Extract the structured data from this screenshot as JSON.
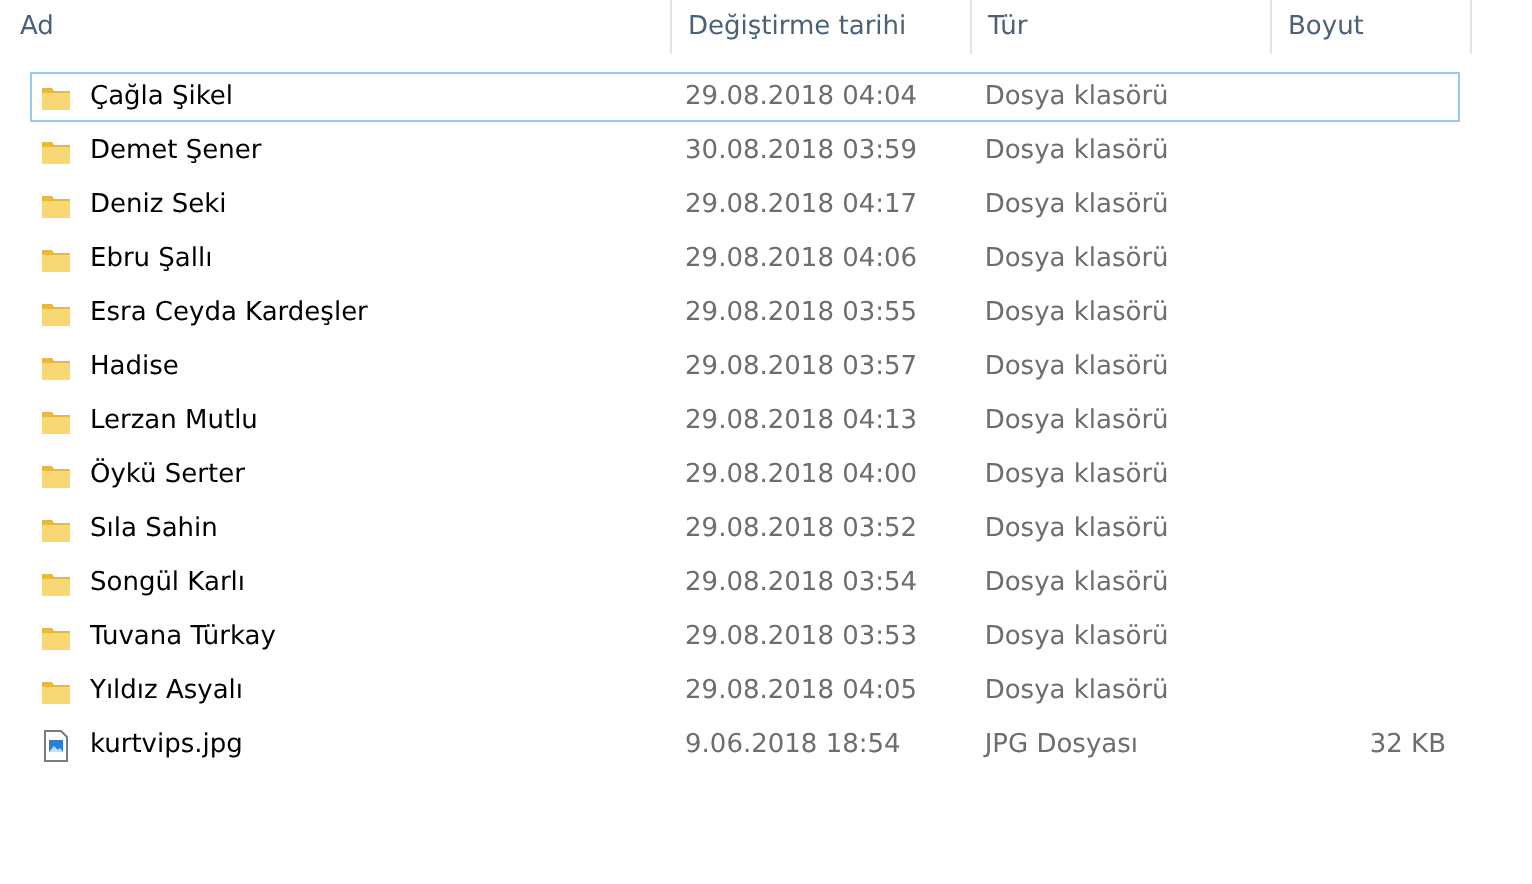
{
  "columns": [
    {
      "label": "Ad"
    },
    {
      "label": "Değiştirme tarihi"
    },
    {
      "label": "Tür"
    },
    {
      "label": "Boyut"
    }
  ],
  "rows": [
    {
      "kind": "folder",
      "name": "Çağla Şikel",
      "date": "29.08.2018 04:04",
      "type": "Dosya klasörü",
      "focused": true
    },
    {
      "kind": "folder",
      "name": "Demet Şener",
      "date": "30.08.2018 03:59",
      "type": "Dosya klasörü",
      "focused": false
    },
    {
      "kind": "folder",
      "name": "Deniz Seki",
      "date": "29.08.2018 04:17",
      "type": "Dosya klasörü",
      "focused": false
    },
    {
      "kind": "folder",
      "name": "Ebru Şallı",
      "date": "29.08.2018 04:06",
      "type": "Dosya klasörü",
      "focused": false
    },
    {
      "kind": "folder",
      "name": "Esra Ceyda Kardeşler",
      "date": "29.08.2018 03:55",
      "type": "Dosya klasörü",
      "focused": false
    },
    {
      "kind": "folder",
      "name": "Hadise",
      "date": "29.08.2018 03:57",
      "type": "Dosya klasörü",
      "focused": false
    },
    {
      "kind": "folder",
      "name": "Lerzan Mutlu",
      "date": "29.08.2018 04:13",
      "type": "Dosya klasörü",
      "focused": false
    },
    {
      "kind": "folder",
      "name": "Öykü Serter",
      "date": "29.08.2018 04:00",
      "type": "Dosya klasörü",
      "focused": false
    },
    {
      "kind": "folder",
      "name": "Sıla Sahin",
      "date": "29.08.2018 03:52",
      "type": "Dosya klasörü",
      "focused": false
    },
    {
      "kind": "folder",
      "name": "Songül Karlı",
      "date": "29.08.2018 03:54",
      "type": "Dosya klasörü",
      "focused": false
    },
    {
      "kind": "folder",
      "name": "Tuvana Türkay",
      "date": "29.08.2018 03:53",
      "type": "Dosya klasörü",
      "focused": false
    },
    {
      "kind": "folder",
      "name": "Yıldız Asyalı",
      "date": "29.08.2018 04:05",
      "type": "Dosya klasörü",
      "focused": false
    },
    {
      "kind": "image",
      "name": "kurtvips.jpg",
      "date": "9.06.2018 18:54",
      "type": "JPG Dosyası",
      "size": "32 KB",
      "focused": false
    }
  ]
}
